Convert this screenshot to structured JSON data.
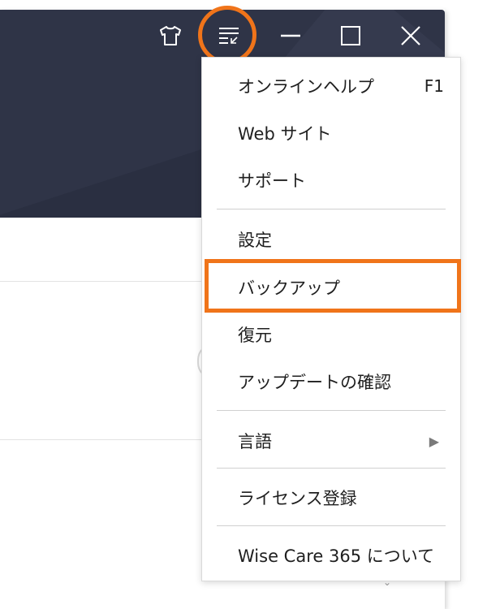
{
  "titlebar": {
    "icons": [
      "shirt-icon",
      "menu-lines-icon",
      "minimize-icon",
      "maximize-icon",
      "close-icon"
    ]
  },
  "menu": {
    "items": [
      {
        "label": "オンラインヘルプ",
        "shortcut": "F1"
      },
      {
        "label": "Web サイト"
      },
      {
        "label": "サポート"
      },
      {
        "label": "設定"
      },
      {
        "label": "バックアップ"
      },
      {
        "label": "復元"
      },
      {
        "label": "アップデートの確認"
      },
      {
        "label": "言語"
      },
      {
        "label": "ライセンス登録"
      },
      {
        "label": "Wise Care 365 について"
      }
    ]
  },
  "colors": {
    "header_bg": "#2f3447",
    "highlight": "#f0741a",
    "menu_bg": "#ffffff"
  }
}
